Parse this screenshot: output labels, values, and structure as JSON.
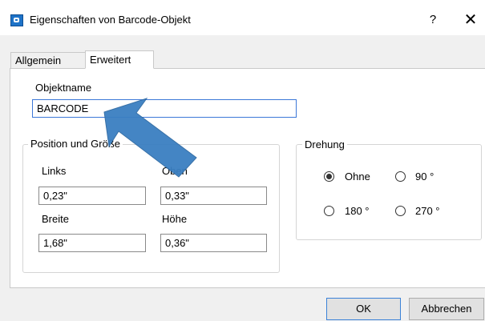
{
  "window": {
    "title": "Eigenschaften von Barcode-Objekt",
    "help_label": "?",
    "close_label": "✕"
  },
  "tabs": [
    {
      "label": "Allgemein"
    },
    {
      "label": "Erweitert"
    }
  ],
  "object_name": {
    "label": "Objektname",
    "value": "BARCODE"
  },
  "position": {
    "group_title": "Position und Größe",
    "left_label": "Links",
    "left_value": "0,23\"",
    "top_label": "Oben",
    "top_value": "0,33\"",
    "width_label": "Breite",
    "width_value": "1,68\"",
    "height_label": "Höhe",
    "height_value": "0,36\""
  },
  "rotation": {
    "group_title": "Drehung",
    "options": [
      {
        "label": "Ohne",
        "selected": true
      },
      {
        "label": "90 °",
        "selected": false
      },
      {
        "label": "180 °",
        "selected": false
      },
      {
        "label": "270 °",
        "selected": false
      }
    ]
  },
  "buttons": {
    "ok": "OK",
    "cancel": "Abbrechen"
  },
  "colors": {
    "arrow": "#3a7fc1",
    "focus_border": "#3c78d8",
    "app_icon": "#1e73c8"
  },
  "icons": {
    "app": "app-icon",
    "close": "close-icon",
    "pointer": "callout-arrow-icon"
  }
}
